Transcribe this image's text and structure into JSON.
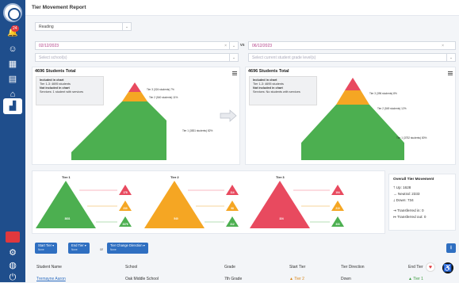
{
  "header": {
    "title": "Tier Movement Report"
  },
  "sidebar": {
    "badge": "24",
    "icons": [
      "home-icon",
      "people-icon",
      "school-icon",
      "calendar-icon",
      "building-icon",
      "chart-icon"
    ]
  },
  "filters": {
    "subject": "Reading",
    "left_date": "02/12/2023",
    "right_date": "06/12/2023",
    "vs": "vs",
    "schools_placeholder": "Select school(s)",
    "grades_placeholder": "Select current student grade level(s)"
  },
  "left_chart": {
    "total": "4696 Students Total",
    "legend": {
      "included_title": "Included in chart",
      "included": "Tier 1-3: 4695 students",
      "excluded_title": "Not included in chart",
      "excluded": "Services: 1 student with services"
    },
    "labels": [
      "Tier 3 (324 students) 7%",
      "Tier 2 (540 students) 11%",
      "Tier 1 (3831 students) 82%"
    ]
  },
  "right_chart": {
    "total": "4696 Students Total",
    "legend": {
      "included_title": "Included in chart",
      "included": "Tier 1-3: 4695 students",
      "excluded_title": "Not included in chart",
      "excluded": "Services: No students with services"
    },
    "labels": [
      "Tier 3 (396 students) 8%",
      "Tier 2 (549 students) 12%",
      "Tier 1 (3752 students) 80%"
    ]
  },
  "flows": {
    "tier1": {
      "label": "Tier 1",
      "count": "3831",
      "out": [
        "178",
        "230",
        "3376"
      ]
    },
    "tier2": {
      "label": "Tier 2",
      "count": "540",
      "out": [
        "114",
        "98",
        "312"
      ]
    },
    "tier3": {
      "label": "Tier 3",
      "count": "324",
      "out": [
        "104",
        "210",
        "333"
      ]
    }
  },
  "overall": {
    "title": "Overall Tier Movement",
    "up": "Up: 1628",
    "neutral": "Neutral: 2333",
    "down": "Down: 734",
    "transferred_in": "Transferred in: 0",
    "transferred_out": "Transferred out: 0"
  },
  "chips": [
    {
      "label": "Start Tier",
      "sub": "None"
    },
    {
      "label": "End Tier",
      "sub": "None"
    },
    {
      "label": "Tier Change Direction",
      "sub": "None"
    }
  ],
  "or_text": "or",
  "table": {
    "headers": [
      "Student Name",
      "School",
      "Grade",
      "Start Tier",
      "Tier Direction",
      "End Tier"
    ],
    "row": [
      "Tremayne Aaron",
      "Oak Middle School",
      "7th Grade",
      "Tier 2",
      "Down",
      "Tier 1"
    ]
  }
}
